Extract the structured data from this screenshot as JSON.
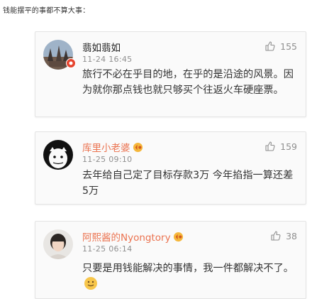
{
  "caption": "钱能摆平的事都不算大事：",
  "comments": [
    {
      "username": "翡如翡如",
      "time": "11-24 16:45",
      "likes": "155",
      "text": "旅行不必在乎目的地，在乎的是沿途的风景。因为就你那点钱也就只够买个往返火车硬座票。",
      "name_color": "#222222"
    },
    {
      "username": "库里小老婆",
      "time": "11-25 09:10",
      "likes": "159",
      "text": "去年给自己定了目标存款3万 今年掐指一算还差5万",
      "name_color": "#eb7350"
    },
    {
      "username": "阿熙酱的Nyongtory",
      "time": "11-25 06:14",
      "likes": "38",
      "text": "只要是用钱能解决的事情，我一件都解决不了。",
      "name_color": "#eb7350"
    }
  ],
  "icons": {
    "like": "thumbs-up-icon",
    "badge": "vip-badge-icon",
    "emoji": "smile-emoji-icon",
    "more": "more-icon"
  }
}
